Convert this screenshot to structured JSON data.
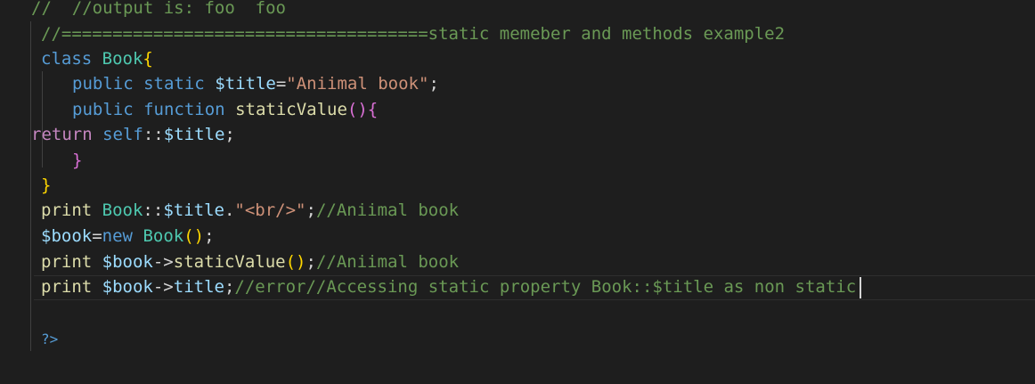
{
  "editor": {
    "theme_colors": {
      "background": "#1e1e1e",
      "comment": "#6a9955",
      "keyword": "#569cd6",
      "control": "#c586c0",
      "type": "#4ec9b0",
      "variable": "#9cdcfe",
      "string": "#ce9178",
      "function": "#dcdcaa",
      "bracket_level1": "#ffd700",
      "bracket_level2": "#da70d6"
    },
    "lines": {
      "l1": {
        "comment": "//  //output is: foo  foo"
      },
      "l2": {
        "comment": "//====================================static memeber and methods example2"
      },
      "l3": {
        "kw": "class",
        "name": "Book",
        "brace": "{"
      },
      "l4": {
        "kw1": "public",
        "kw2": "static",
        "var": "$title",
        "eq": "=",
        "str": "\"Aniimal book\"",
        "semi": ";"
      },
      "l5": {
        "kw1": "public",
        "kw2": "function",
        "fn": "staticValue",
        "paren": "()",
        "brace": "{"
      },
      "l6": {
        "kw": "return",
        "self": "self",
        "op": "::",
        "var": "$title",
        "semi": ";"
      },
      "l7": {
        "brace": "}"
      },
      "l8": {
        "brace": "}"
      },
      "l9": {
        "fn": "print",
        "cls": "Book",
        "op": "::",
        "var": "$title",
        "dot": ".",
        "str": "\"<br/>\"",
        "semi": ";",
        "comment": "//Aniimal book"
      },
      "l10": {
        "var": "$book",
        "eq": "=",
        "kw": "new",
        "cls": "Book",
        "paren": "()",
        "semi": ";"
      },
      "l11": {
        "fn": "print",
        "var": "$book",
        "arrow": "->",
        "method": "staticValue",
        "paren": "()",
        "semi": ";",
        "comment": "//Aniimal book"
      },
      "l12": {
        "fn": "print",
        "var": "$book",
        "arrow": "->",
        "prop": "title",
        "semi": ";",
        "comment": "//error//Accessing static property Book::$title as non static"
      },
      "l13": {
        "tag": "?>"
      }
    }
  }
}
